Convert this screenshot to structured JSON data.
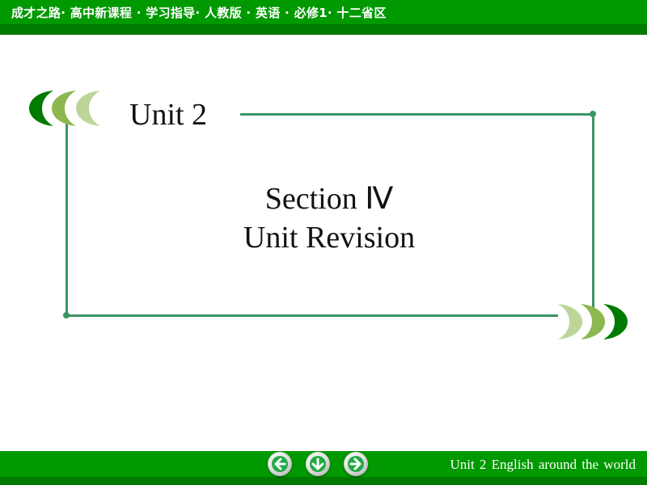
{
  "header": {
    "title": "成才之路· 高中新课程 · 学习指导· 人教版 · 英语 · 必修1· 十二省区"
  },
  "slide": {
    "unit_heading": "Unit 2",
    "section_line1": "Section Ⅳ",
    "section_line2": "Unit Revision"
  },
  "footer": {
    "text": "Unit  2   English  around the world",
    "nav": [
      {
        "name": "previous-button",
        "icon": "arrow-left-icon"
      },
      {
        "name": "home-button",
        "icon": "arrow-down-icon"
      },
      {
        "name": "next-button",
        "icon": "arrow-right-icon"
      }
    ]
  },
  "colors": {
    "bar_green": "#009900",
    "bar_dark_green": "#007a00",
    "frame_green": "#3a9466",
    "crescent_dark": "#007a00",
    "crescent_mid": "#8cb84f",
    "crescent_light": "#bcd69a",
    "arrow_green": "#22aa44"
  }
}
